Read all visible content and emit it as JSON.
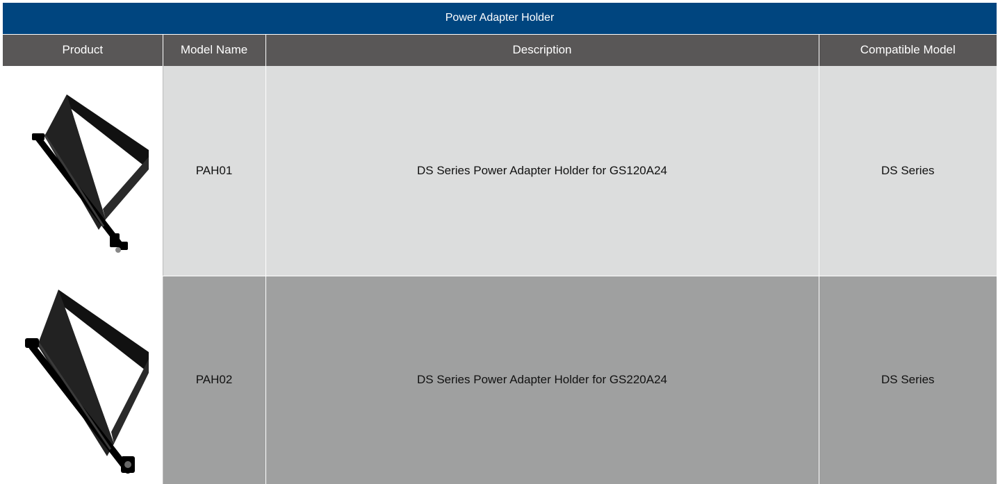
{
  "table": {
    "title": "Power Adapter Holder",
    "headers": {
      "product": "Product",
      "model_name": "Model Name",
      "description": "Description",
      "compatible_model": "Compatible Model"
    },
    "rows": [
      {
        "model_name": "PAH01",
        "description": "DS Series Power Adapter Holder for GS120A24",
        "compatible_model": "DS Series",
        "product_icon": "power-adapter-holder-image"
      },
      {
        "model_name": "PAH02",
        "description": "DS Series Power Adapter Holder for GS220A24",
        "compatible_model": "DS Series",
        "product_icon": "power-adapter-holder-image"
      }
    ]
  },
  "colors": {
    "title_bg": "#00457f",
    "header_bg": "#595757",
    "row1_bg": "#dcdddd",
    "row2_bg": "#9fa0a0"
  }
}
